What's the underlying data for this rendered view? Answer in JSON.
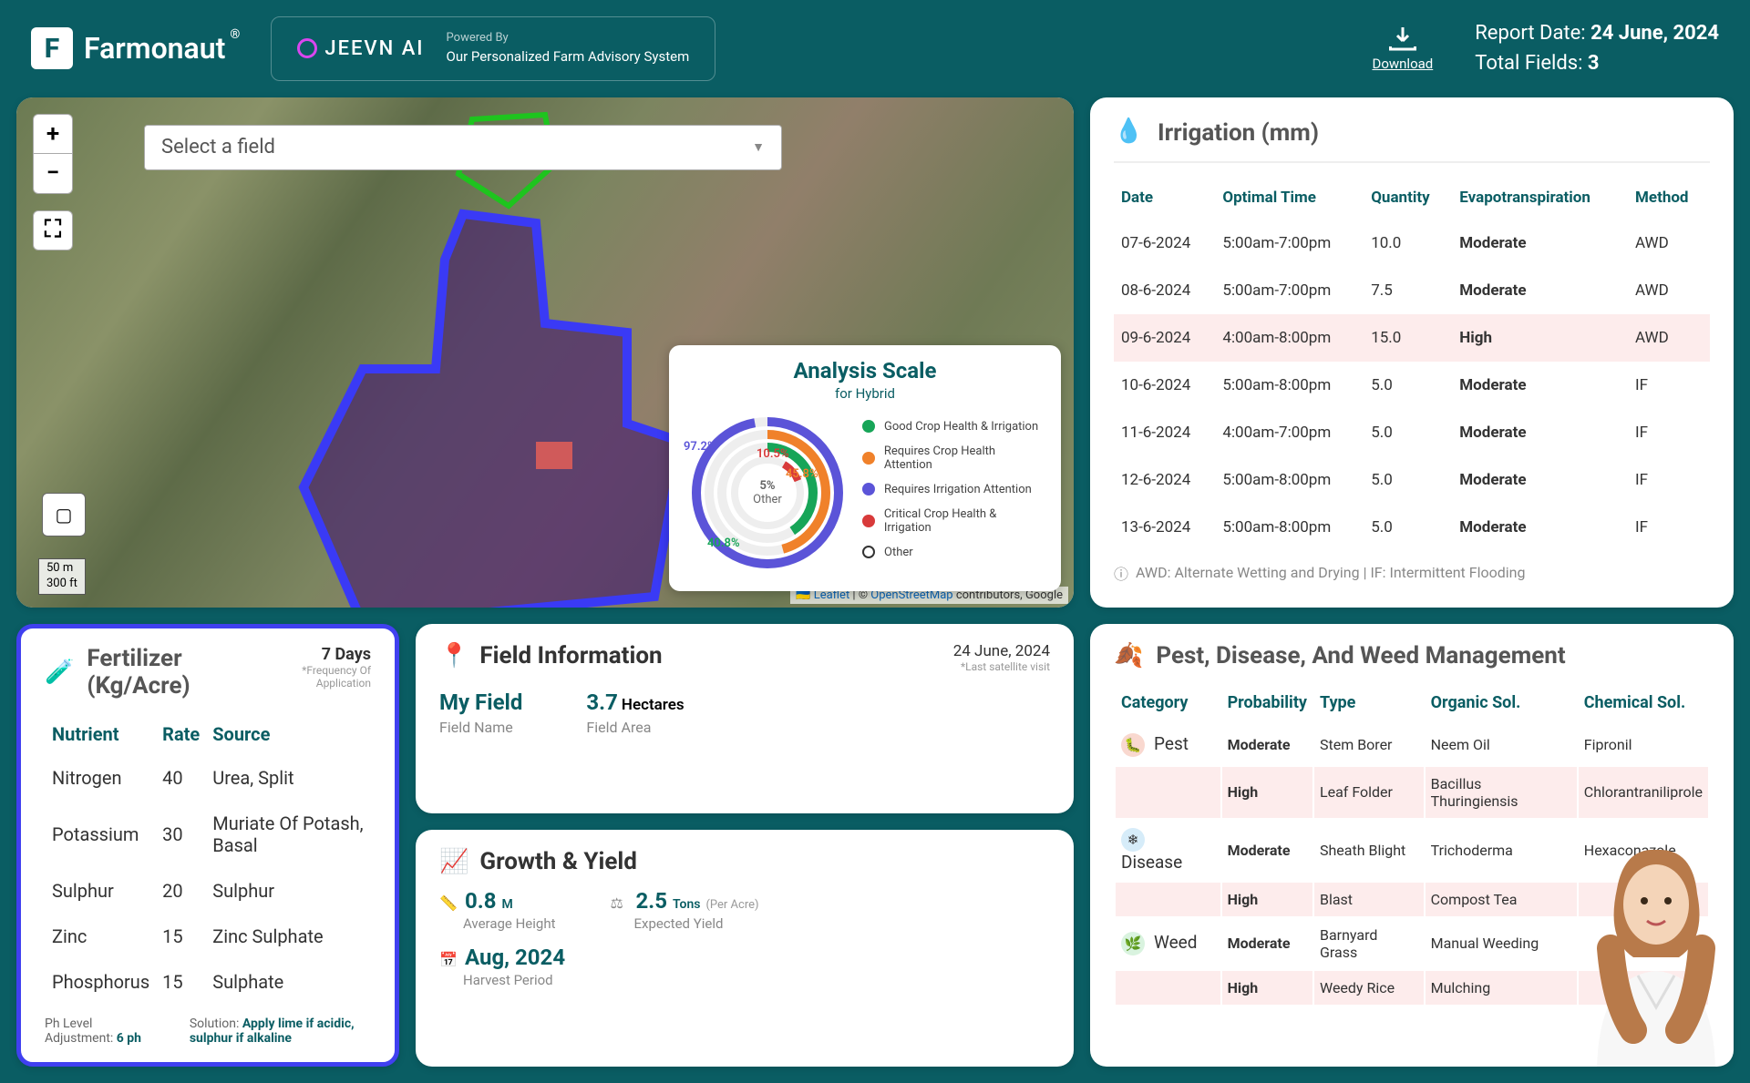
{
  "header": {
    "brand": "Farmonaut",
    "brand_symbol": "®",
    "jeevn_logo": "JEEVN AI",
    "powered_by_label": "Powered By",
    "powered_by_text": "Our Personalized Farm Advisory System",
    "download_label": "Download",
    "report_date_label": "Report Date:",
    "report_date": "24 June, 2024",
    "total_fields_label": "Total Fields:",
    "total_fields": "3"
  },
  "map": {
    "select_placeholder": "Select a field",
    "scale_metric": "50 m",
    "scale_imperial": "300 ft",
    "attrib_leaflet": "Leaflet",
    "attrib_sep": " | © ",
    "attrib_osm": "OpenStreetMap",
    "attrib_tail": " contributors, Google",
    "analysis": {
      "title": "Analysis Scale",
      "subtitle": "for Hybrid",
      "center_pct": "5%",
      "center_label": "Other",
      "pct_a": "97.2%",
      "pct_b": "10.5%",
      "pct_c": "45.8%",
      "pct_d": "40.8%",
      "legend": [
        {
          "color": "#17a558",
          "label": "Good Crop Health & Irrigation"
        },
        {
          "color": "#f0812a",
          "label": "Requires Crop Health Attention"
        },
        {
          "color": "#5b54d8",
          "label": "Requires Irrigation Attention"
        },
        {
          "color": "#d83a3a",
          "label": "Critical Crop Health & Irrigation"
        },
        {
          "color": "#ffffff",
          "label": "Other"
        }
      ]
    }
  },
  "irrigation": {
    "title": "Irrigation (mm)",
    "cols": {
      "date": "Date",
      "time": "Optimal Time",
      "qty": "Quantity",
      "evap": "Evapotranspiration",
      "method": "Method"
    },
    "rows": [
      {
        "date": "07-6-2024",
        "time": "5:00am-7:00pm",
        "qty": "10.0",
        "evap": "Moderate",
        "method": "AWD",
        "high": false
      },
      {
        "date": "08-6-2024",
        "time": "5:00am-7:00pm",
        "qty": "7.5",
        "evap": "Moderate",
        "method": "AWD",
        "high": false
      },
      {
        "date": "09-6-2024",
        "time": "4:00am-8:00pm",
        "qty": "15.0",
        "evap": "High",
        "method": "AWD",
        "high": true
      },
      {
        "date": "10-6-2024",
        "time": "5:00am-8:00pm",
        "qty": "5.0",
        "evap": "Moderate",
        "method": "IF",
        "high": false
      },
      {
        "date": "11-6-2024",
        "time": "4:00am-7:00pm",
        "qty": "5.0",
        "evap": "Moderate",
        "method": "IF",
        "high": false
      },
      {
        "date": "12-6-2024",
        "time": "5:00am-8:00pm",
        "qty": "5.0",
        "evap": "Moderate",
        "method": "IF",
        "high": false
      },
      {
        "date": "13-6-2024",
        "time": "5:00am-8:00pm",
        "qty": "5.0",
        "evap": "Moderate",
        "method": "IF",
        "high": false
      }
    ],
    "note": "AWD: Alternate Wetting and Drying | IF: Intermittent Flooding"
  },
  "field_info": {
    "title": "Field Information",
    "date": "24 June, 2024",
    "date_sub": "*Last satellite visit",
    "name_val": "My Field",
    "name_lab": "Field Name",
    "area_val": "3.7",
    "area_unit": "Hectares",
    "area_lab": "Field Area"
  },
  "growth": {
    "title": "Growth & Yield",
    "height_val": "0.8",
    "height_unit": "M",
    "height_lab": "Average Height",
    "yield_val": "2.5",
    "yield_unit": "Tons",
    "yield_pa": "(Per Acre)",
    "yield_lab": "Expected Yield",
    "harvest_val": "Aug, 2024",
    "harvest_lab": "Harvest Period"
  },
  "fertilizer": {
    "title": "Fertilizer (Kg/Acre)",
    "freq_val": "7 Days",
    "freq_lab": "*Frequency Of Application",
    "cols": {
      "n": "Nutrient",
      "r": "Rate",
      "s": "Source"
    },
    "rows": [
      {
        "n": "Nitrogen",
        "r": "40",
        "s": "Urea, Split"
      },
      {
        "n": "Potassium",
        "r": "30",
        "s": "Muriate Of Potash, Basal"
      },
      {
        "n": "Sulphur",
        "r": "20",
        "s": "Sulphur"
      },
      {
        "n": "Zinc",
        "r": "15",
        "s": "Zinc Sulphate"
      },
      {
        "n": "Phosphorus",
        "r": "15",
        "s": "Sulphate"
      }
    ],
    "ph_label": "Ph Level Adjustment:",
    "ph_val": "6 ph",
    "sol_label": "Solution:",
    "sol_val": "Apply lime if acidic, sulphur if alkaline"
  },
  "pest": {
    "title": "Pest, Disease, And Weed Management",
    "cols": {
      "cat": "Category",
      "prob": "Probability",
      "type": "Type",
      "org": "Organic Sol.",
      "chem": "Chemical Sol."
    },
    "cats": {
      "pest": "Pest",
      "disease": "Disease",
      "weed": "Weed"
    },
    "rows": [
      {
        "cat": "pest",
        "prob": "Moderate",
        "type": "Stem Borer",
        "org": "Neem Oil",
        "chem": "Fipronil",
        "high": false,
        "first": true
      },
      {
        "cat": "pest",
        "prob": "High",
        "type": "Leaf Folder",
        "org": "Bacillus Thuringiensis",
        "chem": "Chlorantraniliprole",
        "high": true,
        "first": false
      },
      {
        "cat": "disease",
        "prob": "Moderate",
        "type": "Sheath Blight",
        "org": "Trichoderma",
        "chem": "Hexaconazole",
        "high": false,
        "first": true
      },
      {
        "cat": "disease",
        "prob": "High",
        "type": "Blast",
        "org": "Compost Tea",
        "chem": "",
        "high": true,
        "first": false
      },
      {
        "cat": "weed",
        "prob": "Moderate",
        "type": "Barnyard Grass",
        "org": "Manual Weeding",
        "chem": "",
        "high": false,
        "first": true
      },
      {
        "cat": "weed",
        "prob": "High",
        "type": "Weedy Rice",
        "org": "Mulching",
        "chem": "",
        "high": true,
        "first": false
      }
    ]
  },
  "chart_data": {
    "type": "pie",
    "title": "Analysis Scale for Hybrid",
    "series": [
      {
        "name": "Good Crop Health & Irrigation",
        "value": 40.8,
        "color": "#17a558"
      },
      {
        "name": "Requires Crop Health Attention",
        "value": 45.8,
        "color": "#f0812a"
      },
      {
        "name": "Requires Irrigation Attention",
        "value": 97.2,
        "color": "#5b54d8"
      },
      {
        "name": "Critical Crop Health & Irrigation",
        "value": 10.5,
        "color": "#d83a3a"
      },
      {
        "name": "Other",
        "value": 5.0,
        "color": "#ffffff"
      }
    ],
    "note": "Concentric ring gauges; each percentage is fraction of its own ring, not shares of a single pie."
  }
}
